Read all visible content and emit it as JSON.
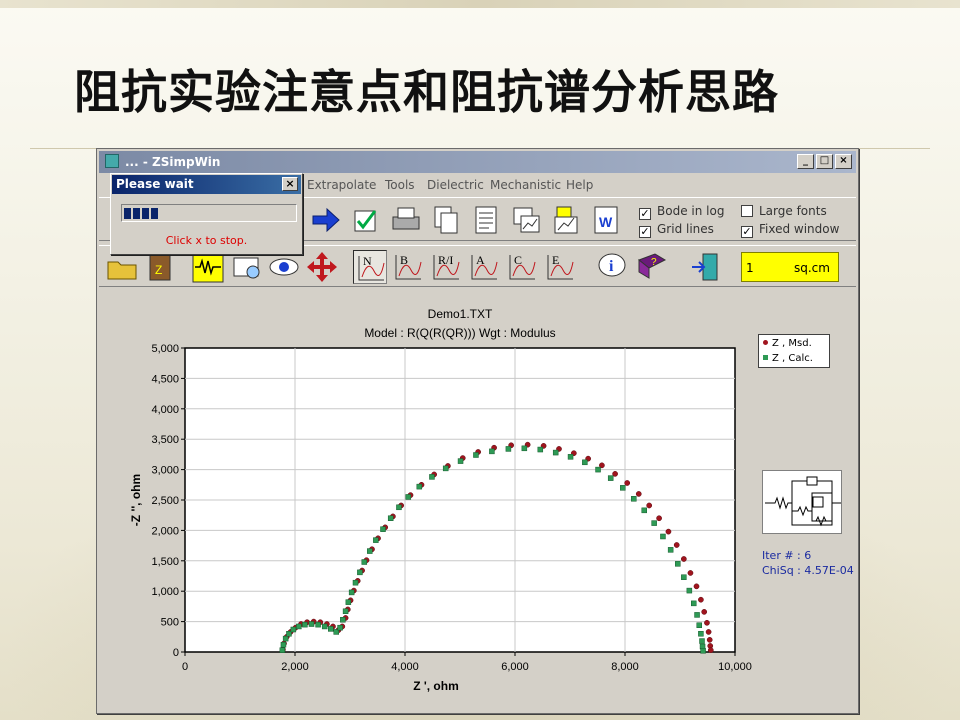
{
  "slide": {
    "title": "阻抗实验注意点和阻抗谱分析思路"
  },
  "window": {
    "title": "... - ZSimpWin",
    "buttons": {
      "minimize": "_",
      "maximize": "□",
      "close": "×"
    }
  },
  "menu": {
    "items": [
      "Extrapolate",
      "Tools",
      "Dielectric",
      "Mechanistic",
      "Help"
    ]
  },
  "dialog": {
    "title": "Please wait",
    "close_label": "×",
    "progress_fraction": 0.2,
    "message": "Click x to stop."
  },
  "options": {
    "bode_in_log": {
      "label": "Bode in log",
      "checked": true
    },
    "grid_lines": {
      "label": "Grid lines",
      "checked": true
    },
    "large_fonts": {
      "label": "Large fonts",
      "checked": false
    },
    "fixed_window": {
      "label": "Fixed window",
      "checked": true
    }
  },
  "area": {
    "value": "1",
    "unit": "sq.cm"
  },
  "plot_buttons": [
    "N",
    "B",
    "R/I",
    "A",
    "C",
    "E"
  ],
  "colors": {
    "measured": "#a0141e",
    "calculated": "#2e9a55",
    "area_bg": "#ffff00"
  },
  "fit": {
    "iter_label": "Iter # :",
    "iter_value": "6",
    "chisq_label": "ChiSq :",
    "chisq_value": "4.57E-04"
  },
  "chart_data": {
    "type": "scatter",
    "title": "Demo1.TXT",
    "subtitle": "Model : R(Q(R(QR)))       Wgt : Modulus",
    "xlabel": "Z ', ohm",
    "ylabel": "-Z '', ohm",
    "xlim": [
      0,
      10000
    ],
    "ylim": [
      0,
      5000
    ],
    "xticks": [
      0,
      2000,
      4000,
      6000,
      8000,
      10000
    ],
    "xtick_labels": [
      "0",
      "2,000",
      "4,000",
      "6,000",
      "8,000",
      "10,000"
    ],
    "yticks": [
      0,
      500,
      1000,
      1500,
      2000,
      2500,
      3000,
      3500,
      4000,
      4500,
      5000
    ],
    "ytick_labels": [
      "0",
      "500",
      "1,000",
      "1,500",
      "2,000",
      "2,500",
      "3,000",
      "3,500",
      "4,000",
      "4,500",
      "5,000"
    ],
    "grid": true,
    "legend_position": "right",
    "series": [
      {
        "name": "Z , Msd.",
        "color": "#a0141e",
        "marker": "circle",
        "x": [
          1780,
          1800,
          1850,
          1920,
          2010,
          2110,
          2220,
          2340,
          2460,
          2580,
          2690,
          2790,
          2860,
          2920,
          2960,
          3010,
          3070,
          3140,
          3220,
          3300,
          3400,
          3510,
          3640,
          3780,
          3930,
          4100,
          4300,
          4530,
          4780,
          5050,
          5330,
          5620,
          5930,
          6230,
          6520,
          6800,
          7070,
          7330,
          7580,
          7820,
          8040,
          8250,
          8440,
          8620,
          8790,
          8940,
          9070,
          9190,
          9300,
          9380,
          9440,
          9490,
          9520,
          9540,
          9550,
          9560
        ],
        "y": [
          40,
          140,
          250,
          330,
          400,
          460,
          490,
          500,
          490,
          460,
          420,
          360,
          420,
          560,
          700,
          850,
          1010,
          1170,
          1340,
          1510,
          1690,
          1870,
          2050,
          2230,
          2410,
          2580,
          2750,
          2920,
          3060,
          3190,
          3290,
          3360,
          3400,
          3410,
          3390,
          3340,
          3270,
          3180,
          3070,
          2930,
          2780,
          2600,
          2410,
          2200,
          1980,
          1760,
          1530,
          1300,
          1080,
          860,
          660,
          480,
          330,
          200,
          100,
          30
        ]
      },
      {
        "name": "Z , Calc.",
        "color": "#2e9a55",
        "marker": "square",
        "x": [
          1770,
          1790,
          1830,
          1890,
          1970,
          2070,
          2180,
          2300,
          2420,
          2540,
          2650,
          2750,
          2820,
          2870,
          2920,
          2970,
          3030,
          3100,
          3180,
          3260,
          3360,
          3470,
          3600,
          3740,
          3890,
          4060,
          4260,
          4490,
          4740,
          5010,
          5290,
          5580,
          5880,
          6170,
          6460,
          6740,
          7010,
          7270,
          7510,
          7740,
          7960,
          8160,
          8350,
          8530,
          8690,
          8830,
          8960,
          9070,
          9170,
          9250,
          9310,
          9350,
          9380,
          9400,
          9410,
          9420
        ],
        "y": [
          30,
          120,
          220,
          300,
          370,
          420,
          450,
          460,
          450,
          420,
          380,
          330,
          400,
          530,
          670,
          820,
          980,
          1140,
          1310,
          1480,
          1660,
          1840,
          2020,
          2200,
          2380,
          2550,
          2720,
          2880,
          3020,
          3140,
          3240,
          3300,
          3340,
          3350,
          3330,
          3280,
          3210,
          3120,
          3000,
          2860,
          2700,
          2520,
          2330,
          2120,
          1900,
          1680,
          1450,
          1230,
          1010,
          800,
          610,
          440,
          300,
          180,
          90,
          20
        ]
      }
    ]
  }
}
